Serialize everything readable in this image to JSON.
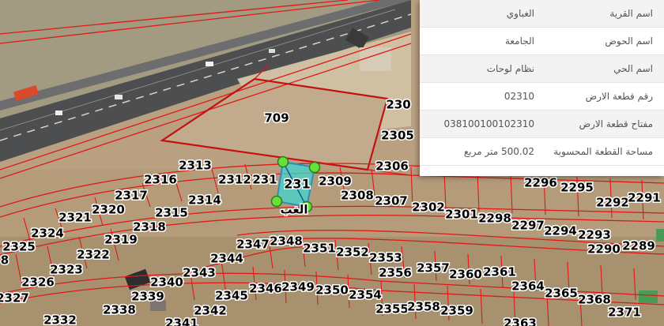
{
  "map": {
    "highlight_color": "#3fd6d0",
    "boundary_color": "#e01818",
    "highlight_label": "231",
    "place_label": "الغب",
    "labels": [
      {
        "name": "parcel-709",
        "text": "709"
      },
      {
        "name": "parcel-2306-a",
        "text": "230"
      },
      {
        "name": "parcel-2305",
        "text": "2305"
      },
      {
        "name": "parcel-2306",
        "text": "2306"
      },
      {
        "name": "parcel-2313",
        "text": "2313"
      },
      {
        "name": "parcel-2316",
        "text": "2316"
      },
      {
        "name": "parcel-2312",
        "text": "2312"
      },
      {
        "name": "parcel-2311",
        "text": "231"
      },
      {
        "name": "parcel-2309",
        "text": "2309"
      },
      {
        "name": "parcel-2317",
        "text": "2317"
      },
      {
        "name": "parcel-2314",
        "text": "2314"
      },
      {
        "name": "parcel-2308",
        "text": "2308"
      },
      {
        "name": "parcel-2307",
        "text": "2307"
      },
      {
        "name": "parcel-2302",
        "text": "2302"
      },
      {
        "name": "parcel-2301",
        "text": "2301"
      },
      {
        "name": "parcel-2298",
        "text": "2298"
      },
      {
        "name": "parcel-2297",
        "text": "2297"
      },
      {
        "name": "parcel-2296",
        "text": "2296"
      },
      {
        "name": "parcel-2295",
        "text": "2295"
      },
      {
        "name": "parcel-2294",
        "text": "2294"
      },
      {
        "name": "parcel-2293",
        "text": "2293"
      },
      {
        "name": "parcel-2292",
        "text": "2292"
      },
      {
        "name": "parcel-2291",
        "text": "2291"
      },
      {
        "name": "parcel-2290",
        "text": "2290"
      },
      {
        "name": "parcel-2289",
        "text": "2289"
      },
      {
        "name": "parcel-2321",
        "text": "2321"
      },
      {
        "name": "parcel-2320",
        "text": "2320"
      },
      {
        "name": "parcel-2315",
        "text": "2315"
      },
      {
        "name": "parcel-2318",
        "text": "2318"
      },
      {
        "name": "parcel-2319",
        "text": "2319"
      },
      {
        "name": "parcel-2324",
        "text": "2324"
      },
      {
        "name": "parcel-2325",
        "text": "2325"
      },
      {
        "name": "parcel-2322",
        "text": "2322"
      },
      {
        "name": "parcel-2323",
        "text": "2323"
      },
      {
        "name": "parcel-2326",
        "text": "2326"
      },
      {
        "name": "parcel-2327",
        "text": "2327"
      },
      {
        "name": "parcel-2340",
        "text": "2340"
      },
      {
        "name": "parcel-2339",
        "text": "2339"
      },
      {
        "name": "parcel-2338",
        "text": "2338"
      },
      {
        "name": "parcel-2332",
        "text": "2332"
      },
      {
        "name": "parcel-2341",
        "text": "2341"
      },
      {
        "name": "parcel-2342",
        "text": "2342"
      },
      {
        "name": "parcel-2343",
        "text": "2343"
      },
      {
        "name": "parcel-2344",
        "text": "2344"
      },
      {
        "name": "parcel-2345",
        "text": "2345"
      },
      {
        "name": "parcel-2347",
        "text": "2347"
      },
      {
        "name": "parcel-2348",
        "text": "2348"
      },
      {
        "name": "parcel-2351",
        "text": "2351"
      },
      {
        "name": "parcel-2352",
        "text": "2352"
      },
      {
        "name": "parcel-2353",
        "text": "2353"
      },
      {
        "name": "parcel-2356",
        "text": "2356"
      },
      {
        "name": "parcel-2357",
        "text": "2357"
      },
      {
        "name": "parcel-2360",
        "text": "2360"
      },
      {
        "name": "parcel-2361",
        "text": "2361"
      },
      {
        "name": "parcel-2364",
        "text": "2364"
      },
      {
        "name": "parcel-2365",
        "text": "2365"
      },
      {
        "name": "parcel-2368",
        "text": "2368"
      },
      {
        "name": "parcel-2346",
        "text": "2346"
      },
      {
        "name": "parcel-2349",
        "text": "2349"
      },
      {
        "name": "parcel-2350",
        "text": "2350"
      },
      {
        "name": "parcel-2354",
        "text": "2354"
      },
      {
        "name": "parcel-2355",
        "text": "2355"
      },
      {
        "name": "parcel-2358",
        "text": "2358"
      },
      {
        "name": "parcel-2359",
        "text": "2359"
      },
      {
        "name": "parcel-2363",
        "text": "2363"
      },
      {
        "name": "parcel-2371",
        "text": "2371"
      },
      {
        "name": "parcel-8",
        "text": "8"
      }
    ]
  },
  "panel": {
    "rows": [
      {
        "key": "اسم القرية",
        "value": "الغباوي"
      },
      {
        "key": "اسم الحوض",
        "value": "الجامعة"
      },
      {
        "key": "اسم الحي",
        "value": "نظام لوحات"
      },
      {
        "key": "رقم قطعة الارض",
        "value": "02310"
      },
      {
        "key": "مفتاح قطعة الارض",
        "value": "038100100102310"
      },
      {
        "key": "مساحة القطعة المحسوبة",
        "value": "500.02 متر مربع"
      }
    ]
  }
}
